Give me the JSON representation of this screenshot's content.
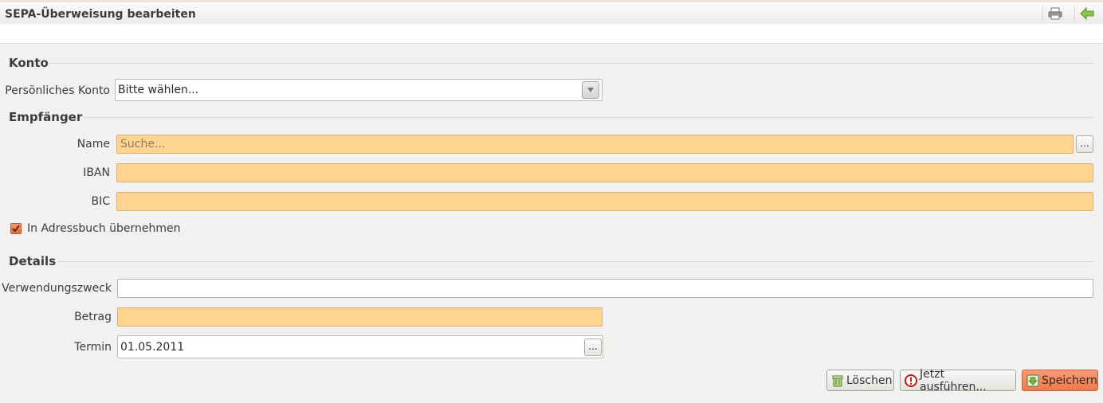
{
  "window": {
    "title": "SEPA-Überweisung bearbeiten"
  },
  "sections": {
    "konto": "Konto",
    "empfaenger": "Empfänger",
    "details": "Details"
  },
  "konto": {
    "account_label": "Persönliches Konto",
    "account_value": "Bitte wählen..."
  },
  "empfaenger": {
    "name_label": "Name",
    "name_placeholder": "Suche...",
    "name_value": "",
    "iban_label": "IBAN",
    "iban_value": "",
    "bic_label": "BIC",
    "bic_value": "",
    "addressbook_label": "In Adressbuch übernehmen",
    "addressbook_checked": true,
    "browse_label": "..."
  },
  "details": {
    "purpose_label": "Verwendungszweck",
    "purpose_value": "",
    "amount_label": "Betrag",
    "amount_value": "",
    "date_label": "Termin",
    "date_value": "01.05.2011",
    "date_button_label": "..."
  },
  "buttons": {
    "delete": "Löschen",
    "execute_now": "Jetzt ausführen...",
    "save": "Speichern"
  },
  "colors": {
    "required_field": "#ffd490",
    "accent": "#ee7a4f"
  },
  "icons": {
    "print": "printer-icon",
    "back": "back-arrow-icon",
    "delete": "trash-icon",
    "execute": "warning-icon",
    "save": "save-icon"
  }
}
